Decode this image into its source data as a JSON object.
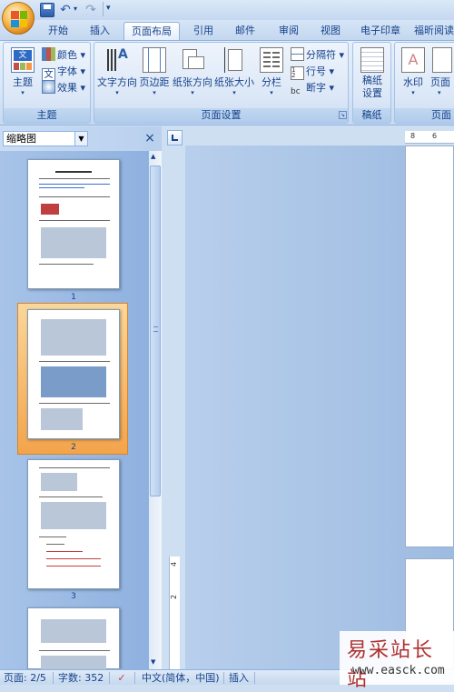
{
  "titlebar": {
    "qa_save": "save-icon",
    "qa_undo": "undo-icon",
    "qa_redo": "redo-icon",
    "qa_more": "▾"
  },
  "tabs": [
    "开始",
    "插入",
    "页面布局",
    "引用",
    "邮件",
    "审阅",
    "视图",
    "电子印章",
    "福昕阅读"
  ],
  "active_tab": "页面布局",
  "ribbon": {
    "theme_group": {
      "label": "主题",
      "big": "主题",
      "items": [
        "颜色",
        "字体",
        "效果"
      ]
    },
    "page_setup_group": {
      "label": "页面设置",
      "buttons": [
        "文字方向",
        "页边距",
        "纸张方向",
        "纸张大小",
        "分栏"
      ],
      "small": [
        "分隔符",
        "行号",
        "断字"
      ]
    },
    "draft_group": {
      "label": "稿纸",
      "button": "稿纸设置"
    },
    "bg_group": {
      "label": "页面",
      "buttons": [
        "水印",
        "页面"
      ]
    }
  },
  "nav_pane": {
    "dropdown_value": "缩略图",
    "close": "×",
    "thumbnails": [
      "1",
      "2",
      "3"
    ],
    "selected_page": "2"
  },
  "ruler": {
    "h_marks": [
      "8",
      "6"
    ],
    "v_marks": [
      "4",
      "2"
    ]
  },
  "status": {
    "page": "页面: 2/5",
    "words": "字数: 352",
    "lang": "中文(简体，中国)",
    "mode": "插入"
  },
  "watermark": {
    "title": "易采站长站",
    "url": "www.easck.com"
  }
}
